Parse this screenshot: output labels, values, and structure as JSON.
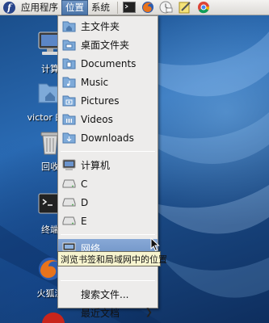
{
  "panel": {
    "applications_label": "应用程序",
    "places_label": "位置",
    "system_label": "系统"
  },
  "places_menu": {
    "bookmarks": [
      "主文件夹",
      "桌面文件夹",
      "Documents",
      "Music",
      "Pictures",
      "Videos",
      "Downloads"
    ],
    "devices": [
      "计算机",
      "C",
      "D",
      "E"
    ],
    "network": "网络",
    "search": "搜索文件...",
    "recent": "最近文档"
  },
  "tooltip": "浏览书签和局域网中的位置",
  "desktop": {
    "icons": [
      "计算",
      "victor 的主",
      "回收",
      "终端",
      "火狐浏"
    ]
  },
  "colors": {
    "folder_blue": "#6f9fd8",
    "highlight": "#6d92c6",
    "tooltip_bg": "#f7f4cf"
  }
}
